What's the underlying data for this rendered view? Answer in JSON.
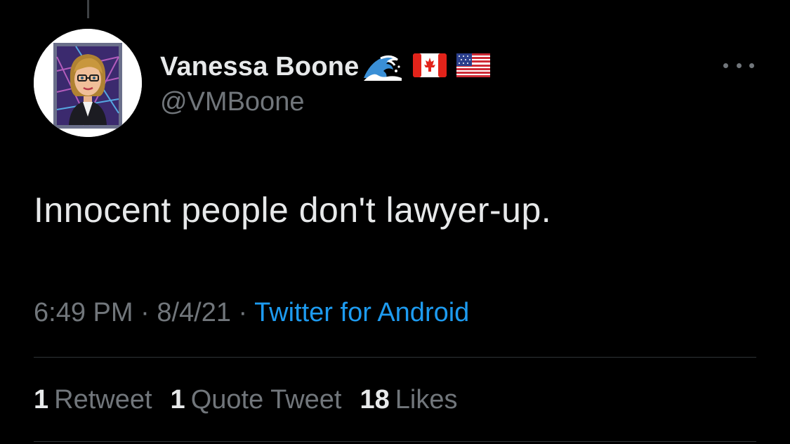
{
  "author": {
    "display_name": "Vanessa Boone",
    "handle": "@VMBoone",
    "badges": [
      "wave-icon",
      "flag-canada-icon",
      "flag-usa-icon"
    ]
  },
  "tweet": {
    "text": "Innocent people don't lawyer-up."
  },
  "meta": {
    "time": "6:49 PM",
    "separator": " · ",
    "date": "8/4/21",
    "source": "Twitter for Android"
  },
  "stats": [
    {
      "count": "1",
      "label": "Retweet"
    },
    {
      "count": "1",
      "label": "Quote Tweet"
    },
    {
      "count": "18",
      "label": "Likes"
    }
  ],
  "colors": {
    "background": "#000000",
    "primary_text": "#e7e9ea",
    "secondary_text": "#71767b",
    "link": "#1d9bf0",
    "divider": "#2f3336"
  },
  "icons": {
    "more": "more-options-icon"
  }
}
